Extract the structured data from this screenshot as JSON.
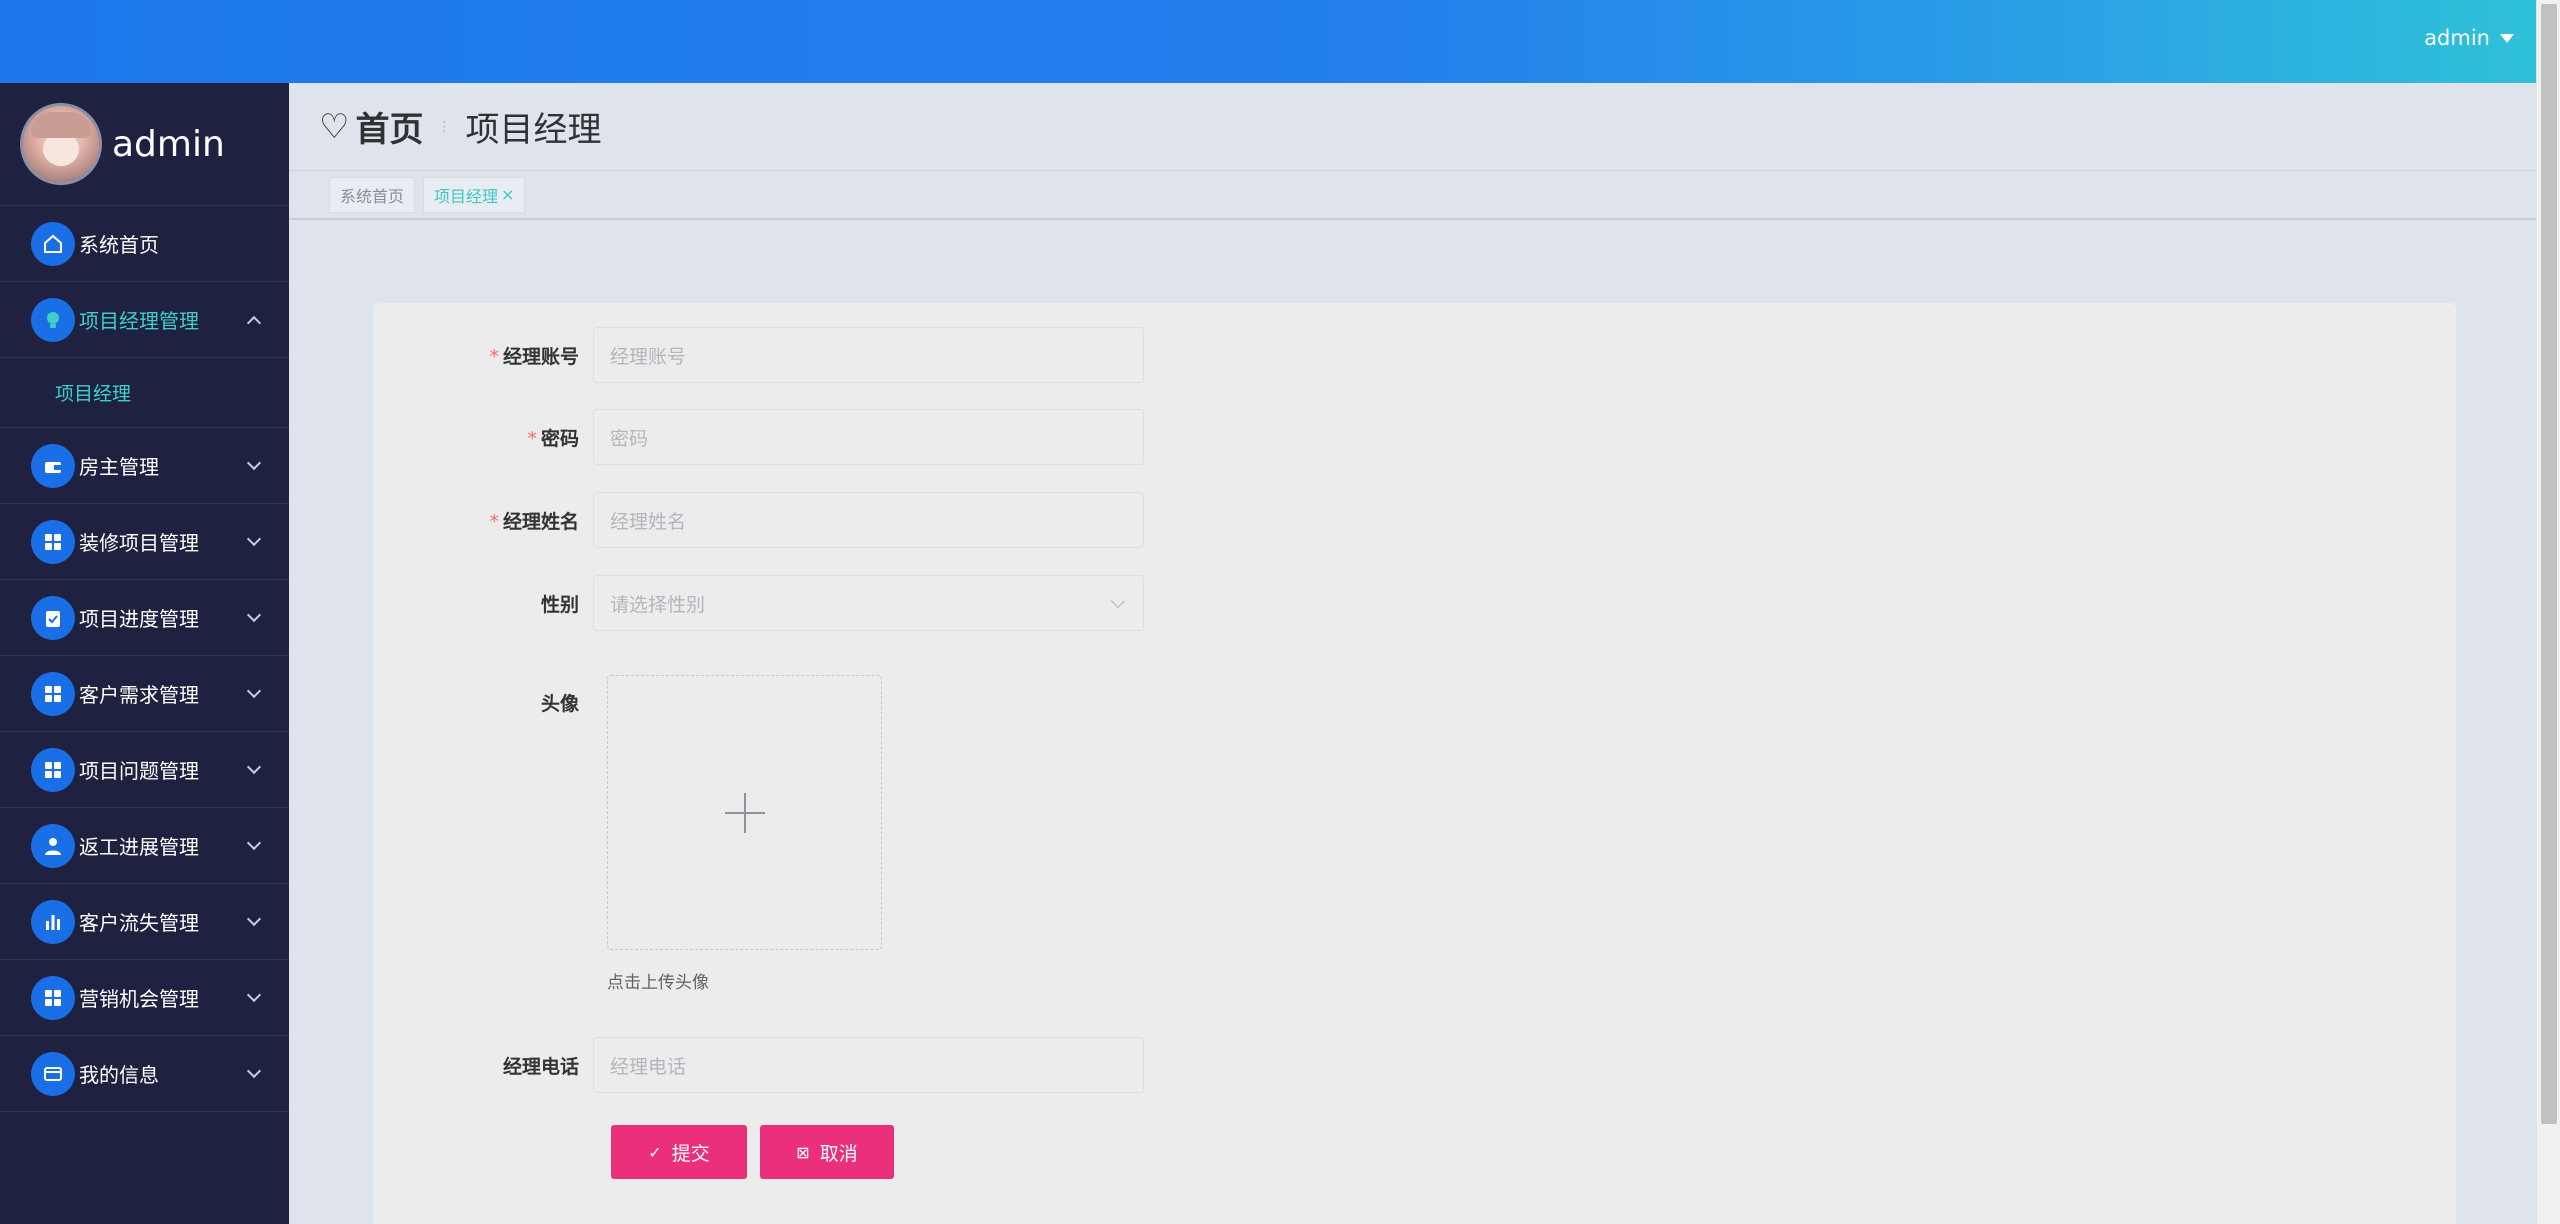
{
  "header": {
    "username": "admin"
  },
  "sidebar": {
    "user_name": "admin",
    "items": [
      {
        "label": "系统首页",
        "icon": "home-icon"
      },
      {
        "label": "项目经理管理",
        "icon": "bulb-icon",
        "expanded": true,
        "children": [
          {
            "label": "项目经理"
          }
        ]
      },
      {
        "label": "房主管理",
        "icon": "wallet-icon"
      },
      {
        "label": "装修项目管理",
        "icon": "grid-icon"
      },
      {
        "label": "项目进度管理",
        "icon": "clipboard-icon"
      },
      {
        "label": "客户需求管理",
        "icon": "grid-icon"
      },
      {
        "label": "项目问题管理",
        "icon": "grid-icon"
      },
      {
        "label": "返工进展管理",
        "icon": "user-icon"
      },
      {
        "label": "客户流失管理",
        "icon": "bar-chart-icon"
      },
      {
        "label": "营销机会管理",
        "icon": "grid-icon"
      },
      {
        "label": "我的信息",
        "icon": "card-icon"
      }
    ]
  },
  "breadcrumb": {
    "home": "首页",
    "current": "项目经理"
  },
  "tags": [
    {
      "label": "系统首页",
      "active": false
    },
    {
      "label": "项目经理",
      "active": true,
      "close": "×"
    }
  ],
  "form": {
    "account": {
      "label": "经理账号",
      "placeholder": "经理账号",
      "required": true
    },
    "password": {
      "label": "密码",
      "placeholder": "密码",
      "required": true
    },
    "name": {
      "label": "经理姓名",
      "placeholder": "经理姓名",
      "required": true
    },
    "gender": {
      "label": "性别",
      "placeholder": "请选择性别"
    },
    "avatar": {
      "label": "头像",
      "hint": "点击上传头像"
    },
    "phone": {
      "label": "经理电话",
      "placeholder": "经理电话"
    },
    "submit_label": "提交",
    "cancel_label": "取消"
  },
  "colors": {
    "accent": "#3fd0c8",
    "button": "#ec2f7b",
    "sidebar_bg": "#1e2140",
    "topbar": "#1c78ea"
  }
}
